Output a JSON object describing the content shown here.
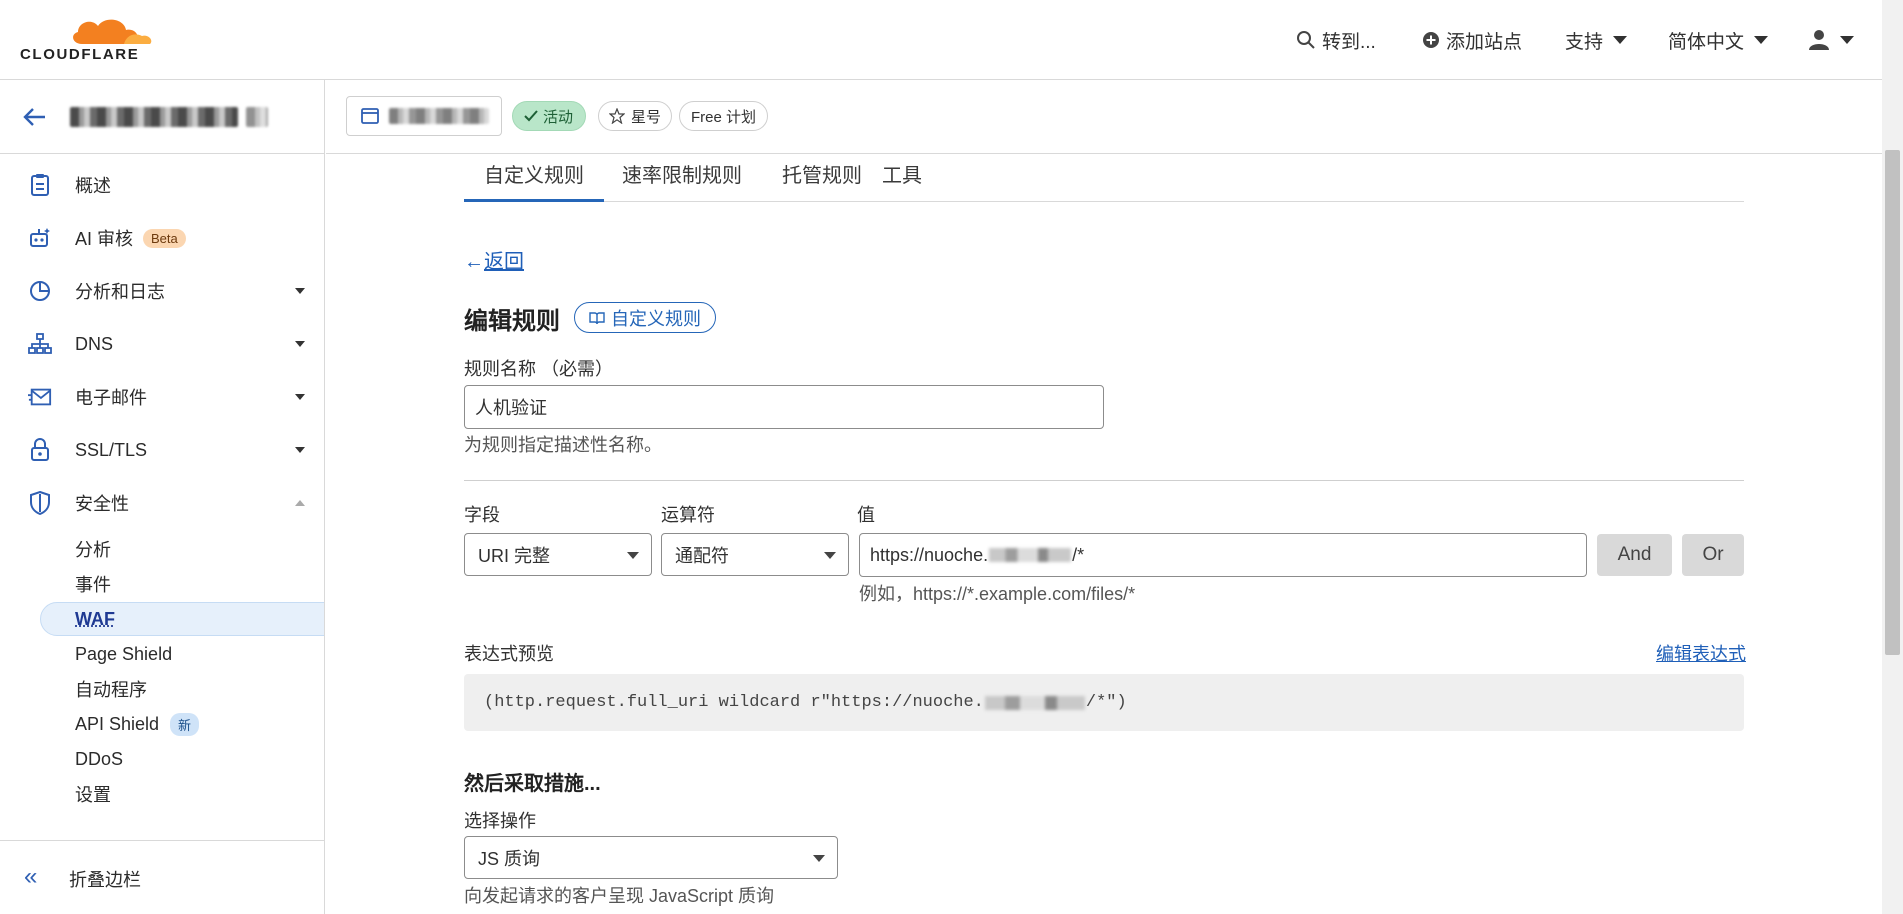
{
  "brand": {
    "logo_text": "CLOUDFLARE",
    "orange": "#f38020",
    "orange_light": "#fbad41"
  },
  "topbar": {
    "goto_label": "转到...",
    "add_site_label": "添加站点",
    "support_label": "支持",
    "language_label": "简体中文"
  },
  "sidebar": {
    "items": [
      {
        "label": "概述",
        "icon": "clipboard-icon"
      },
      {
        "label": "AI 审核",
        "icon": "robot-icon",
        "badge": "Beta"
      },
      {
        "label": "分析和日志",
        "icon": "pie-chart-icon"
      },
      {
        "label": "DNS",
        "icon": "network-icon"
      },
      {
        "label": "电子邮件",
        "icon": "email-icon"
      },
      {
        "label": "SSL/TLS",
        "icon": "lock-icon"
      },
      {
        "label": "安全性",
        "icon": "shield-icon"
      }
    ],
    "security_sub": [
      {
        "label": "分析"
      },
      {
        "label": "事件"
      },
      {
        "label": "WAF"
      },
      {
        "label": "Page Shield"
      },
      {
        "label": "自动程序"
      },
      {
        "label": "API Shield",
        "badge": "新"
      },
      {
        "label": "DDoS"
      },
      {
        "label": "设置"
      }
    ],
    "collapse_label": "折叠边栏"
  },
  "subheader": {
    "status_label": "活动",
    "star_label": "星号",
    "plan_label": "Free 计划"
  },
  "tabs": [
    "自定义规则",
    "速率限制规则",
    "托管规则",
    "工具"
  ],
  "form": {
    "back_label": "返回",
    "title": "编辑规则",
    "doc_link_label": "自定义规则",
    "rule_name_label": "规则名称 （必需）",
    "rule_name_value": "人机验证",
    "rule_name_hint": "为规则指定描述性名称。",
    "field_label": "字段",
    "field_value": "URI 完整",
    "operator_label": "运算符",
    "operator_value": "通配符",
    "value_label": "值",
    "value_prefix": "https://nuoche.",
    "value_suffix": "/*",
    "value_hint": "例如，https://*.example.com/files/*",
    "and_label": "And",
    "or_label": "Or",
    "expr_preview_label": "表达式预览",
    "edit_expr_label": "编辑表达式",
    "expr_prefix": "(http.request.full_uri wildcard r\"https://nuoche.",
    "expr_suffix": "/*\")",
    "then_label": "然后采取措施...",
    "action_label": "选择操作",
    "action_value": "JS 质询",
    "action_hint": "向发起请求的客户呈现 JavaScript 质询"
  }
}
